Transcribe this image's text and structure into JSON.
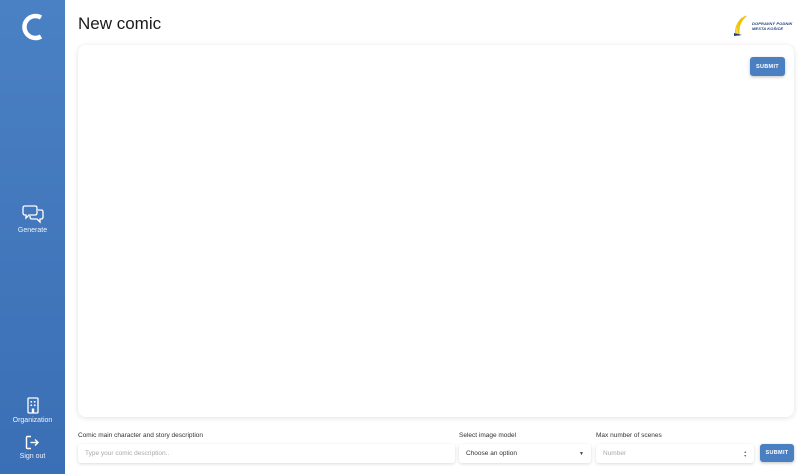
{
  "header": {
    "title": "New comic"
  },
  "company_logo": {
    "line1": "DOPRAVNÝ PODNIK",
    "line2": "MESTA KOŠICE"
  },
  "sidebar": {
    "items": [
      {
        "label": "Generate",
        "icon": "chat-bubbles-icon"
      },
      {
        "label": "Organization",
        "icon": "building-icon"
      },
      {
        "label": "Sign out",
        "icon": "sign-out-icon"
      }
    ]
  },
  "panel": {
    "submit_label": "SUBMIT"
  },
  "form": {
    "description": {
      "label": "Comic main character and story description",
      "placeholder": "Type your comic description..",
      "value": ""
    },
    "image_model": {
      "label": "Select image model",
      "selected": "Choose an option"
    },
    "max_scenes": {
      "label": "Max number of scenes",
      "placeholder": "Number"
    },
    "submit_label": "SUBMIT"
  },
  "colors": {
    "sidebar": "#4a80c4",
    "accent": "#4a7fc1",
    "logo_text": "#1f3f7a"
  }
}
